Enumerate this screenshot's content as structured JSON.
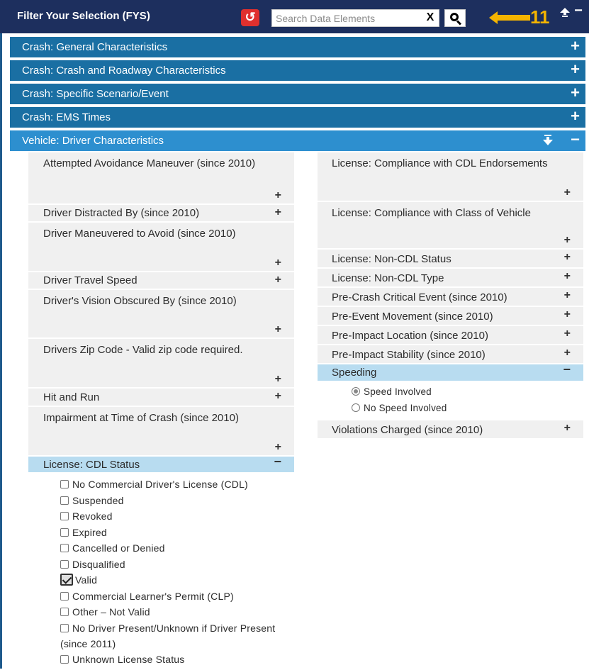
{
  "header": {
    "title": "Filter Your Selection (FYS)",
    "undo_icon": "undo-icon",
    "search": {
      "placeholder": "Search Data Elements",
      "value": "",
      "clear_label": "X"
    },
    "annotation_number": "11",
    "expand_all_icon": "double-chevron-up-icon",
    "collapse_all_label": "−"
  },
  "sections": [
    {
      "label": "Crash: General Characteristics",
      "toggle": "+"
    },
    {
      "label": "Crash: Crash and Roadway Characteristics",
      "toggle": "+"
    },
    {
      "label": "Crash: Specific Scenario/Event",
      "toggle": "+"
    },
    {
      "label": "Crash: EMS Times",
      "toggle": "+"
    },
    {
      "label": "Vehicle: Driver Characteristics",
      "toggle": "−",
      "arrow": "⯯"
    }
  ],
  "left_items": [
    {
      "label": "Attempted Avoidance Maneuver (since 2010)",
      "toggle": "+"
    },
    {
      "label": "Driver Distracted By (since 2010)",
      "toggle": "+"
    },
    {
      "label": "Driver Maneuvered to Avoid (since 2010)",
      "toggle": "+"
    },
    {
      "label": "Driver Travel Speed",
      "toggle": "+"
    },
    {
      "label": "Driver's Vision Obscured By (since 2010)",
      "toggle": "+"
    },
    {
      "label": "Drivers Zip Code - Valid zip code required.",
      "toggle": "+"
    },
    {
      "label": "Hit and Run",
      "toggle": "+"
    },
    {
      "label": "Impairment at Time of Crash (since 2010)",
      "toggle": "+"
    },
    {
      "label": "License: CDL Status",
      "toggle": "−"
    }
  ],
  "cdl_options": [
    {
      "label": "No Commercial Driver's License (CDL)",
      "checked": false
    },
    {
      "label": "Suspended",
      "checked": false
    },
    {
      "label": "Revoked",
      "checked": false
    },
    {
      "label": "Expired",
      "checked": false
    },
    {
      "label": "Cancelled or Denied",
      "checked": false
    },
    {
      "label": "Disqualified",
      "checked": false
    },
    {
      "label": "Valid",
      "checked": true
    },
    {
      "label": "Commercial Learner's Permit (CLP)",
      "checked": false
    },
    {
      "label": "Other – Not Valid",
      "checked": false
    },
    {
      "label": "No Driver Present/Unknown if Driver Present (since 2011)",
      "checked": false
    },
    {
      "label": "Unknown License Status",
      "checked": false
    }
  ],
  "right_items": [
    {
      "label": "License: Compliance with CDL Endorsements",
      "toggle": "+"
    },
    {
      "label": "License: Compliance with Class of Vehicle",
      "toggle": "+"
    },
    {
      "label": "License: Non-CDL Status",
      "toggle": "+"
    },
    {
      "label": "License: Non-CDL Type",
      "toggle": "+"
    },
    {
      "label": "Pre-Crash Critical Event (since 2010)",
      "toggle": "+"
    },
    {
      "label": "Pre-Event Movement (since 2010)",
      "toggle": "+"
    },
    {
      "label": "Pre-Impact Location (since 2010)",
      "toggle": "+"
    },
    {
      "label": "Pre-Impact Stability (since 2010)",
      "toggle": "+"
    },
    {
      "label": "Speeding",
      "toggle": "−"
    }
  ],
  "speeding_options": [
    {
      "label": "Speed Involved",
      "checked": true
    },
    {
      "label": "No Speed Involved",
      "checked": false
    }
  ],
  "right_items_after": [
    {
      "label": "Violations Charged (since 2010)",
      "toggle": "+"
    }
  ],
  "colors": {
    "topbar": "#1d2f5e",
    "section": "#1a6fa3",
    "section_open": "#2d8fcf",
    "undo": "#e0302e",
    "annotation": "#f5b400",
    "item_bg": "#f0f0f0",
    "item_open_bg": "#b8dcf0"
  }
}
